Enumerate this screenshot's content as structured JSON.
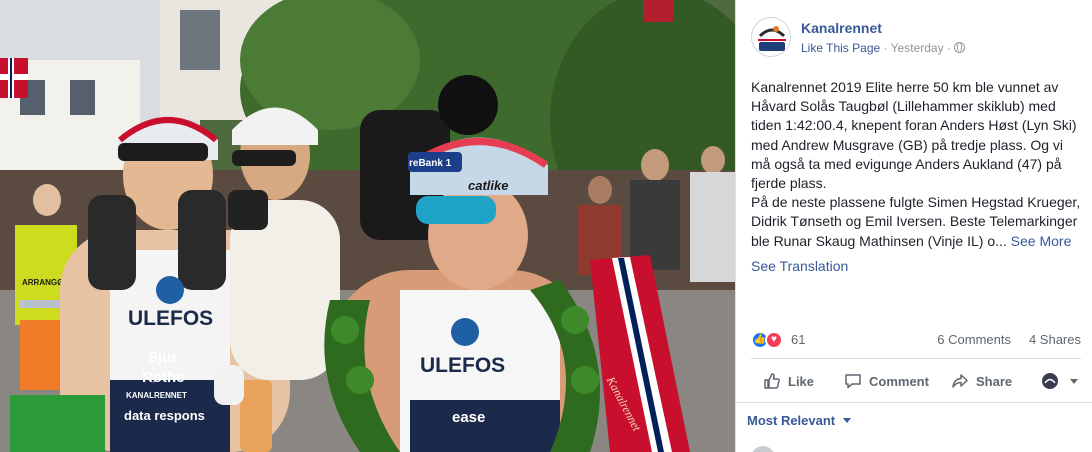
{
  "photo": {
    "alt_subject": "",
    "jersey_sponsor_left": "ULEFOS",
    "jersey_name_left_1": "Sjur",
    "jersey_name_left_2": "Røthe",
    "jersey_sponsor_center": "ULEFOS",
    "wreath_ribbon_text": "Kanalrennet",
    "vest_text": "ARRANGØR",
    "helmet_text": "catlike",
    "bank_text": "reBank 1",
    "sponsor_footer_left": "KANALRENNET",
    "sponsor_footer_left_2": "data respons",
    "shirt_bottom_center": "ease"
  },
  "post": {
    "page_name": "Kanalrennet",
    "like_page_link": "Like This Page",
    "separator": "·",
    "timestamp": "Yesterday",
    "separator2": "·",
    "audience_icon": "globe-icon",
    "text_p1": "Kanalrennet 2019 Elite herre 50 km ble vunnet av Håvard Solås Taugbøl (Lillehammer skiklub) med tiden 1:42:00.4, knepent foran Anders Høst (Lyn Ski) med Andrew Musgrave (GB) på tredje plass. Og vi må også ta med evigunge Anders Aukland (47) på fjerde plass.",
    "text_p2": "På de neste plassene fulgte Simen Hegstad Krueger, Didrik Tønseth og Emil Iversen. Beste Telemarkinger ble Runar Skaug Mathinsen (Vinje IL) o...",
    "see_more": "See More",
    "see_translation": "See Translation"
  },
  "stats": {
    "reaction_count": "61",
    "comments": "6 Comments",
    "shares": "4 Shares",
    "reaction_icons": [
      "like-icon",
      "love-icon"
    ]
  },
  "actions": {
    "like": "Like",
    "comment": "Comment",
    "share": "Share"
  },
  "comments": {
    "sort_label": "Most Relevant"
  },
  "colors": {
    "fb_blue": "#385898",
    "text": "#1d2129",
    "muted": "#90949c",
    "like_blue": "#1877f2",
    "love_red": "#f33e58"
  }
}
